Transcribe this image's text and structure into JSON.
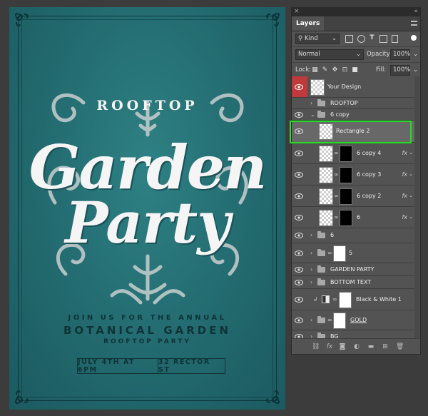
{
  "poster": {
    "rooftop": "ROOFTOP",
    "garden": "Garden",
    "party": "Party",
    "join": "JOIN US FOR THE ANNUAL",
    "botanical": "BOTANICAL GARDEN",
    "rooftop_party": "ROOFTOP PARTY",
    "date": "JULY 4TH AT 6PM",
    "address": "32 RECTOR ST"
  },
  "panel": {
    "close": "×",
    "collapse": "«",
    "tab": "Layers",
    "filter_kind": "Kind",
    "blend_mode": "Normal",
    "opacity_label": "Opacity:",
    "opacity_value": "100%",
    "lock_label": "Lock:",
    "fill_label": "Fill:",
    "fill_value": "100%"
  },
  "layers": [
    {
      "name": "Your Design",
      "type": "smart",
      "selected_red": true
    },
    {
      "name": "ROOFTOP",
      "type": "group"
    },
    {
      "name": "6 copy",
      "type": "group",
      "expanded": true
    },
    {
      "name": "Rectangle 2",
      "type": "smart",
      "highlighted": true
    },
    {
      "name": "6 copy 4",
      "type": "masked"
    },
    {
      "name": "6 copy 3",
      "type": "masked"
    },
    {
      "name": "6 copy 2",
      "type": "masked"
    },
    {
      "name": "6",
      "type": "masked"
    },
    {
      "name": "6",
      "type": "group"
    },
    {
      "name": "5",
      "type": "group-mask"
    },
    {
      "name": "GARDEN PARTY",
      "type": "group"
    },
    {
      "name": "BOTTOM TEXT",
      "type": "group"
    },
    {
      "name": "Black & White 1",
      "type": "adjustment"
    },
    {
      "name": "GOLD",
      "type": "group-mask"
    },
    {
      "name": "BG",
      "type": "group"
    }
  ],
  "fx_label": "fx",
  "colors": {
    "poster_bg": "#226a6f",
    "highlight": "#23e023",
    "eye_bg_selected": "#c0393b",
    "panel_bg": "#535353"
  }
}
